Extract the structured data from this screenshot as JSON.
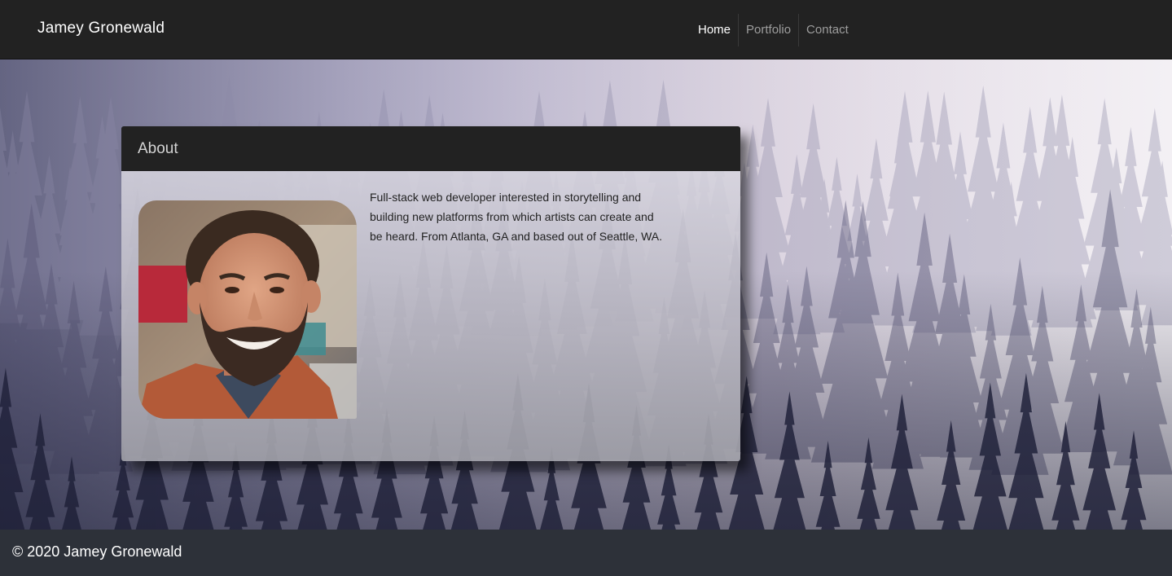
{
  "navbar": {
    "brand": "Jamey Gronewald",
    "links": [
      {
        "label": "Home",
        "active": true
      },
      {
        "label": "Portfolio",
        "active": false
      },
      {
        "label": "Contact",
        "active": false
      }
    ]
  },
  "about": {
    "title": "About",
    "bio": "Full-stack web developer interested in storytelling and building new platforms from which artists can create and be heard. From Atlanta, GA and based out of Seattle, WA."
  },
  "footer": {
    "text": "© 2020 Jamey Gronewald"
  },
  "colors": {
    "navbar_bg": "#222222",
    "footer_bg": "#2d3139",
    "card_header_bg": "#222222",
    "nav_active": "#ffffff",
    "nav_inactive": "#9d9d9d"
  }
}
